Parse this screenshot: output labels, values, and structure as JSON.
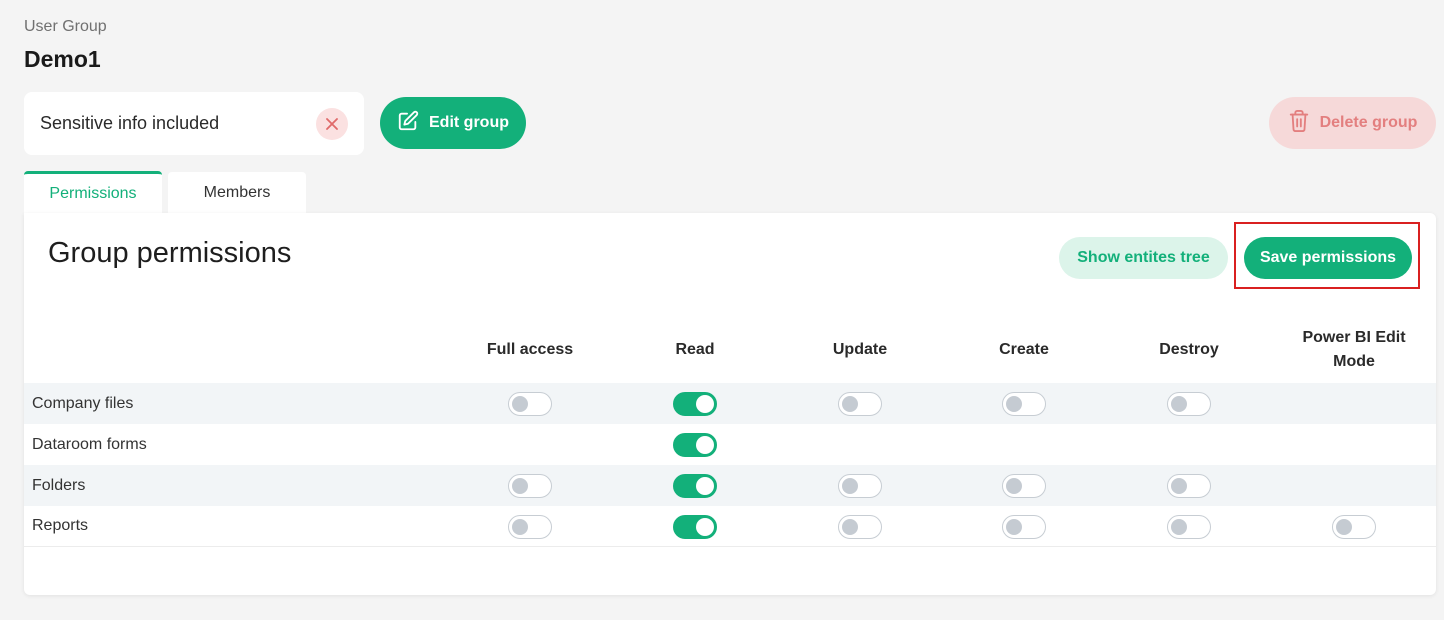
{
  "header": {
    "subtitle": "User Group",
    "title": "Demo1"
  },
  "sensitive": {
    "label": "Sensitive info included"
  },
  "actions": {
    "edit_label": "Edit group",
    "delete_label": "Delete group"
  },
  "tabs": [
    {
      "label": "Permissions",
      "active": true
    },
    {
      "label": "Members",
      "active": false
    }
  ],
  "panel": {
    "title": "Group permissions",
    "show_tree_label": "Show entites tree",
    "save_label": "Save permissions"
  },
  "columns": [
    "Full access",
    "Read",
    "Update",
    "Create",
    "Destroy",
    "Power BI Edit Mode"
  ],
  "rows": [
    {
      "label": "Company files",
      "toggles": [
        false,
        true,
        false,
        false,
        false,
        null
      ]
    },
    {
      "label": "Dataroom forms",
      "toggles": [
        null,
        true,
        null,
        null,
        null,
        null
      ]
    },
    {
      "label": "Folders",
      "toggles": [
        false,
        true,
        false,
        false,
        false,
        null
      ]
    },
    {
      "label": "Reports",
      "toggles": [
        false,
        true,
        false,
        false,
        false,
        false
      ]
    }
  ],
  "colors": {
    "accent": "#13b07a",
    "danger": "#e37f7f",
    "danger_bg": "#f6d9d9",
    "highlight_frame": "#d92020"
  }
}
